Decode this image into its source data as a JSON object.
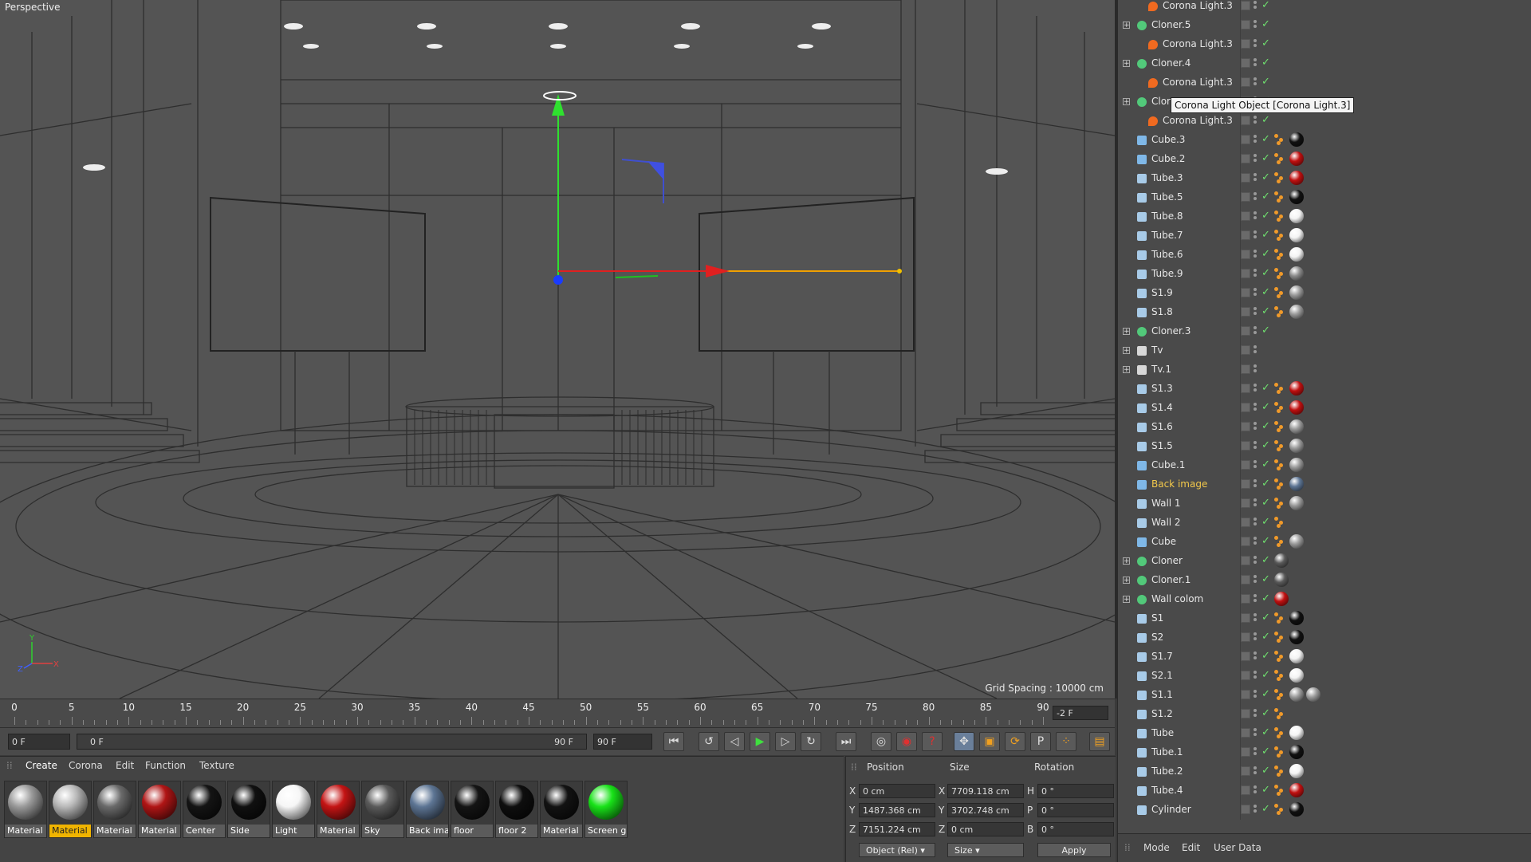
{
  "viewport": {
    "label": "Perspective",
    "grid_spacing": "Grid Spacing : 10000 cm"
  },
  "timeline": {
    "ticks": [
      "0",
      "5",
      "10",
      "15",
      "20",
      "25",
      "30",
      "35",
      "40",
      "45",
      "50",
      "55",
      "60",
      "65",
      "70",
      "75",
      "80",
      "85",
      "90"
    ],
    "current_frame": "-2 F"
  },
  "transport": {
    "start_frame": "0 F",
    "range_start": "0 F",
    "range_end": "90 F",
    "end_frame": "90 F"
  },
  "material_manager": {
    "menus": [
      "Create",
      "Corona",
      "Edit",
      "Function",
      "Texture"
    ],
    "materials": [
      {
        "label": "Material",
        "color": "#9a9a9a",
        "selected": false
      },
      {
        "label": "Material",
        "color": "#b9b9b9",
        "selected": true
      },
      {
        "label": "Material",
        "color": "#6a6a6a",
        "selected": false
      },
      {
        "label": "Material",
        "color": "#b01515",
        "selected": false
      },
      {
        "label": "Center",
        "color": "#141414",
        "selected": false
      },
      {
        "label": "Side",
        "color": "#101010",
        "selected": false
      },
      {
        "label": "Light",
        "color": "#f6f6f6",
        "selected": false
      },
      {
        "label": "Material",
        "color": "#c41414",
        "selected": false
      },
      {
        "label": "Sky",
        "color": "#5a5a5a",
        "selected": false
      },
      {
        "label": "Back ima",
        "color": "#5d7594",
        "selected": false
      },
      {
        "label": "floor",
        "color": "#141414",
        "selected": false
      },
      {
        "label": "floor 2",
        "color": "#0e0e0e",
        "selected": false
      },
      {
        "label": "Material",
        "color": "#121212",
        "selected": false
      },
      {
        "label": "Screen g",
        "color": "#18e218",
        "selected": false
      }
    ]
  },
  "coordinates": {
    "headers": {
      "position": "Position",
      "size": "Size",
      "rotation": "Rotation"
    },
    "rows": [
      {
        "axis": "X",
        "pos": "0 cm",
        "size_axis": "X",
        "size": "7709.118 cm",
        "rot_axis": "H",
        "rot": "0 °"
      },
      {
        "axis": "Y",
        "pos": "1487.368 cm",
        "size_axis": "Y",
        "size": "3702.748 cm",
        "rot_axis": "P",
        "rot": "0 °"
      },
      {
        "axis": "Z",
        "pos": "7151.224 cm",
        "size_axis": "Z",
        "size": "0 cm",
        "rot_axis": "B",
        "rot": "0 °"
      }
    ],
    "mode_select": "Object (Rel)",
    "size_select": "Size",
    "apply": "Apply"
  },
  "object_manager": {
    "tooltip": "Corona Light Object [Corona Light.3]",
    "bottom_menus": [
      "Mode",
      "Edit",
      "User Data"
    ],
    "rows": [
      {
        "name": "Corona Light.3",
        "type": "light",
        "indent": 1,
        "tags": []
      },
      {
        "name": "Cloner.5",
        "type": "cloner",
        "indent": 0,
        "tags": []
      },
      {
        "name": "Corona Light.3",
        "type": "light",
        "indent": 1,
        "tags": []
      },
      {
        "name": "Cloner.4",
        "type": "cloner",
        "indent": 0,
        "tags": []
      },
      {
        "name": "Corona Light.3",
        "type": "light",
        "indent": 1,
        "tags": []
      },
      {
        "name": "Clor",
        "type": "cloner",
        "indent": 0,
        "tags": []
      },
      {
        "name": "Corona Light.3",
        "type": "light",
        "indent": 1,
        "tags": []
      },
      {
        "name": "Cube.3",
        "type": "cube",
        "indent": 0,
        "tags": [
          "#111111"
        ]
      },
      {
        "name": "Cube.2",
        "type": "cube",
        "indent": 0,
        "tags": [
          "#c01010"
        ]
      },
      {
        "name": "Tube.3",
        "type": "tube",
        "indent": 0,
        "tags": [
          "#c01010"
        ]
      },
      {
        "name": "Tube.5",
        "type": "tube",
        "indent": 0,
        "tags": [
          "#111111"
        ]
      },
      {
        "name": "Tube.8",
        "type": "tube",
        "indent": 0,
        "tags": [
          "#f4f4f4"
        ]
      },
      {
        "name": "Tube.7",
        "type": "tube",
        "indent": 0,
        "tags": [
          "#f4f4f4"
        ]
      },
      {
        "name": "Tube.6",
        "type": "tube",
        "indent": 0,
        "tags": [
          "#f4f4f4"
        ]
      },
      {
        "name": "Tube.9",
        "type": "tube",
        "indent": 0,
        "tags": [
          "#8a8a8a"
        ]
      },
      {
        "name": "S1.9",
        "type": "tube",
        "indent": 0,
        "tags": [
          "#9a9a9a"
        ]
      },
      {
        "name": "S1.8",
        "type": "tube",
        "indent": 0,
        "tags": [
          "#9a9a9a"
        ]
      },
      {
        "name": "Cloner.3",
        "type": "cloner",
        "indent": 0,
        "tags": []
      },
      {
        "name": "Tv",
        "type": "null",
        "indent": 0,
        "tags": []
      },
      {
        "name": "Tv.1",
        "type": "null",
        "indent": 0,
        "tags": []
      },
      {
        "name": "S1.3",
        "type": "tube",
        "indent": 0,
        "tags": [
          "#c01010"
        ]
      },
      {
        "name": "S1.4",
        "type": "tube",
        "indent": 0,
        "tags": [
          "#c01010"
        ]
      },
      {
        "name": "S1.6",
        "type": "tube",
        "indent": 0,
        "tags": [
          "#9a9a9a"
        ]
      },
      {
        "name": "S1.5",
        "type": "tube",
        "indent": 0,
        "tags": [
          "#9a9a9a"
        ]
      },
      {
        "name": "Cube.1",
        "type": "cube",
        "indent": 0,
        "tags": [
          "#9a9a9a"
        ]
      },
      {
        "name": "Back image",
        "type": "plane",
        "indent": 0,
        "tags": [
          "#5d7594"
        ],
        "highlight": true
      },
      {
        "name": "Wall 1",
        "type": "tube",
        "indent": 0,
        "tags": [
          "#9a9a9a"
        ]
      },
      {
        "name": "Wall 2",
        "type": "tube",
        "indent": 0,
        "tags": []
      },
      {
        "name": "Cube",
        "type": "cube",
        "indent": 0,
        "tags": [
          "#9a9a9a"
        ]
      },
      {
        "name": "Cloner",
        "type": "cloner",
        "indent": 0,
        "tags": [
          "#5a5a5a"
        ]
      },
      {
        "name": "Cloner.1",
        "type": "cloner",
        "indent": 0,
        "tags": [
          "#5a5a5a"
        ]
      },
      {
        "name": "Wall colom",
        "type": "cloner",
        "indent": 0,
        "tags": [
          "#c01010"
        ]
      },
      {
        "name": "S1",
        "type": "tube",
        "indent": 0,
        "tags": [
          "#111111"
        ]
      },
      {
        "name": "S2",
        "type": "tube",
        "indent": 0,
        "tags": [
          "#111111"
        ]
      },
      {
        "name": "S1.7",
        "type": "tube",
        "indent": 0,
        "tags": [
          "#f4f4f4"
        ]
      },
      {
        "name": "S2.1",
        "type": "tube",
        "indent": 0,
        "tags": [
          "#f4f4f4"
        ]
      },
      {
        "name": "S1.1",
        "type": "tube",
        "indent": 0,
        "tags": [
          "#9a9a9a",
          "#9a9a9a"
        ]
      },
      {
        "name": "S1.2",
        "type": "tube",
        "indent": 0,
        "tags": []
      },
      {
        "name": "Tube",
        "type": "tube",
        "indent": 0,
        "tags": [
          "#f4f4f4"
        ]
      },
      {
        "name": "Tube.1",
        "type": "tube",
        "indent": 0,
        "tags": [
          "#111111"
        ]
      },
      {
        "name": "Tube.2",
        "type": "tube",
        "indent": 0,
        "tags": [
          "#f4f4f4"
        ]
      },
      {
        "name": "Tube.4",
        "type": "tube",
        "indent": 0,
        "tags": [
          "#c01010"
        ]
      },
      {
        "name": "Cylinder",
        "type": "tube",
        "indent": 0,
        "tags": [
          "#111111"
        ]
      }
    ]
  }
}
